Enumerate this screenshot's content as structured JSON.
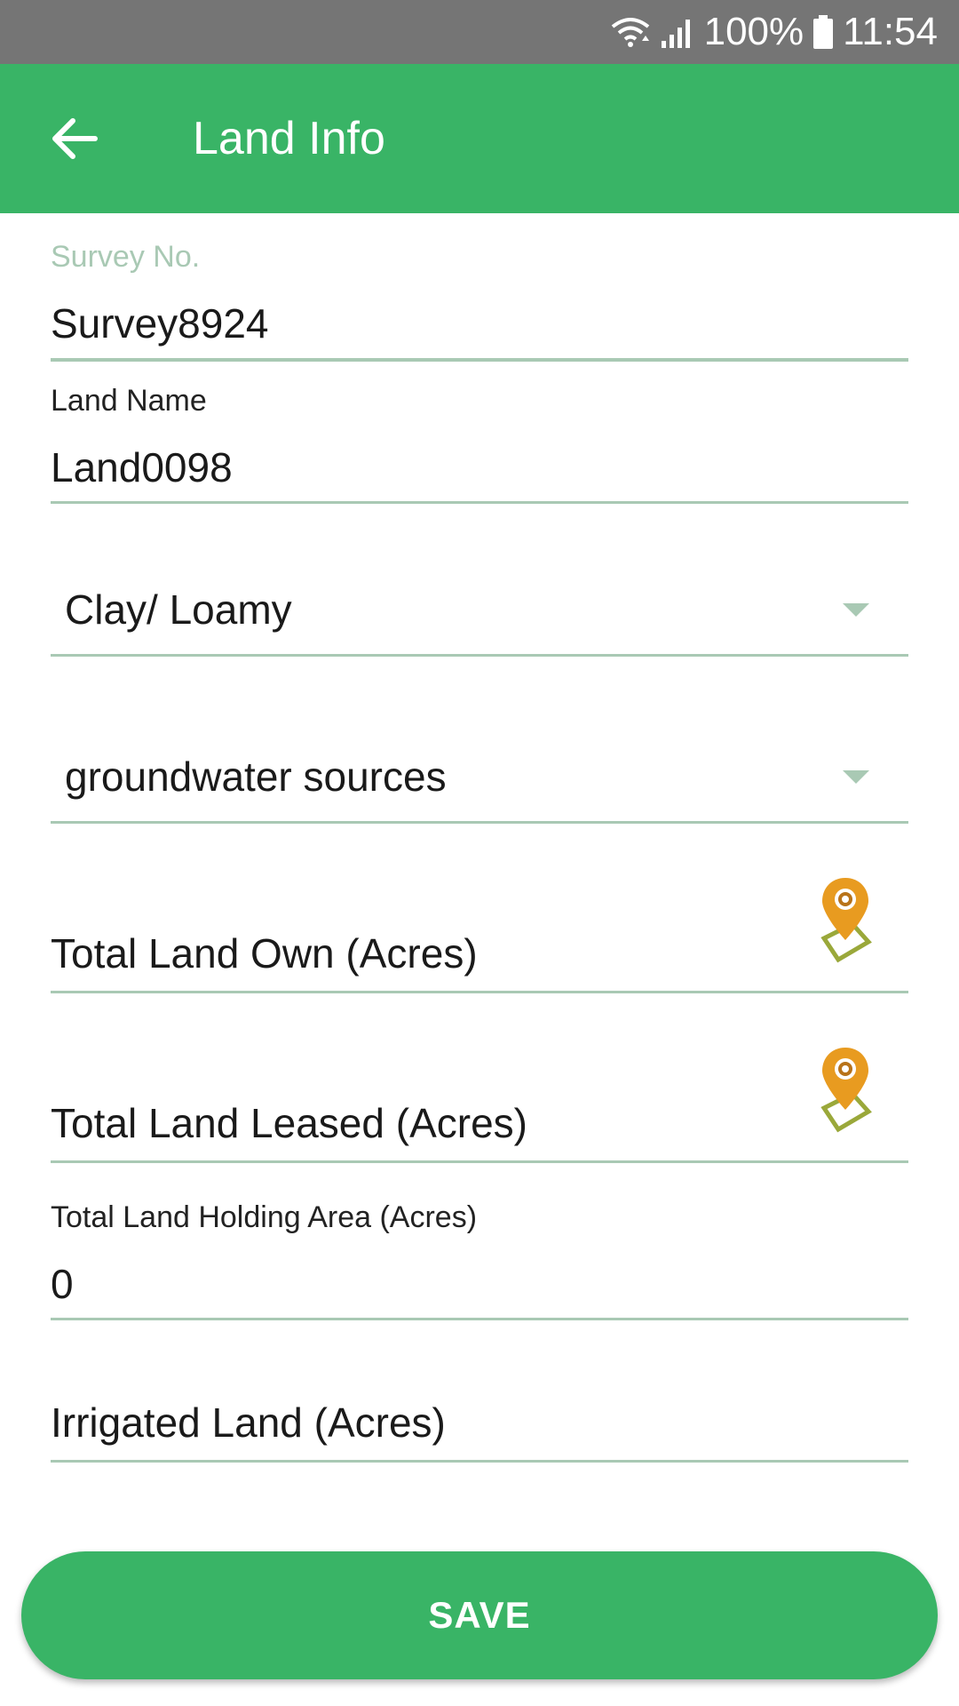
{
  "status_bar": {
    "battery": "100%",
    "time": "11:54",
    "icons": [
      "wifi-icon",
      "signal-icon",
      "battery-icon"
    ]
  },
  "app_bar": {
    "title": "Land Info",
    "back_icon": "arrow-left-icon",
    "color": "#39b466"
  },
  "form": {
    "survey_no": {
      "label": "Survey No.",
      "value": "Survey8924"
    },
    "land_name": {
      "label": "Land Name",
      "value": "Land0098"
    },
    "soil_type": {
      "selected": "Clay/ Loamy"
    },
    "water_source": {
      "selected": "groundwater sources"
    },
    "total_land_own": {
      "placeholder": "Total Land Own (Acres)",
      "icon": "map-pin-icon"
    },
    "total_land_leased": {
      "placeholder": "Total Land Leased (Acres)",
      "icon": "map-pin-icon"
    },
    "total_land_holding": {
      "label": "Total Land Holding Area (Acres)",
      "value": "0"
    },
    "irrigated_land": {
      "placeholder": "Irrigated Land (Acres)"
    }
  },
  "actions": {
    "save_label": "SAVE"
  },
  "colors": {
    "accent": "#39b466",
    "underline": "#a9c9b4",
    "pin": "#e89b20",
    "status_bar": "#757575"
  }
}
